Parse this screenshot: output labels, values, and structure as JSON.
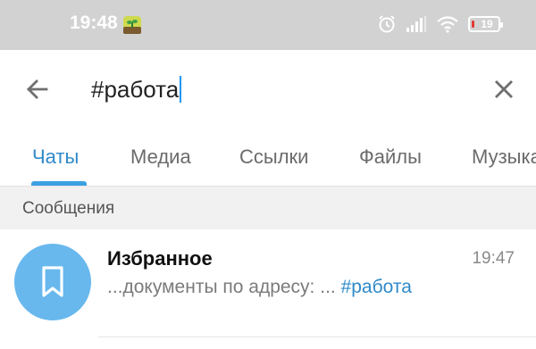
{
  "status_bar": {
    "time": "19:48",
    "app_icon": "plant-app-icon",
    "alarm_icon": "alarm-icon",
    "signal_icon": "signal-icon",
    "wifi_icon": "wifi-icon",
    "battery_level": "19",
    "battery_color": "#e53935"
  },
  "search": {
    "query": "#работа",
    "back_icon": "arrow-left-icon",
    "clear_icon": "close-icon"
  },
  "tabs": [
    {
      "label": "Чаты",
      "active": true
    },
    {
      "label": "Медиа",
      "active": false
    },
    {
      "label": "Ссылки",
      "active": false
    },
    {
      "label": "Файлы",
      "active": false
    },
    {
      "label": "Музыка",
      "active": false
    }
  ],
  "section": {
    "title": "Сообщения"
  },
  "results": [
    {
      "title": "Избранное",
      "time": "19:47",
      "snippet_prefix": "...документы по адресу: ... ",
      "snippet_match": "#работа",
      "avatar_icon": "bookmark-icon",
      "avatar_color": "#68b8ee"
    }
  ],
  "accent_color": "#2f8ac9"
}
